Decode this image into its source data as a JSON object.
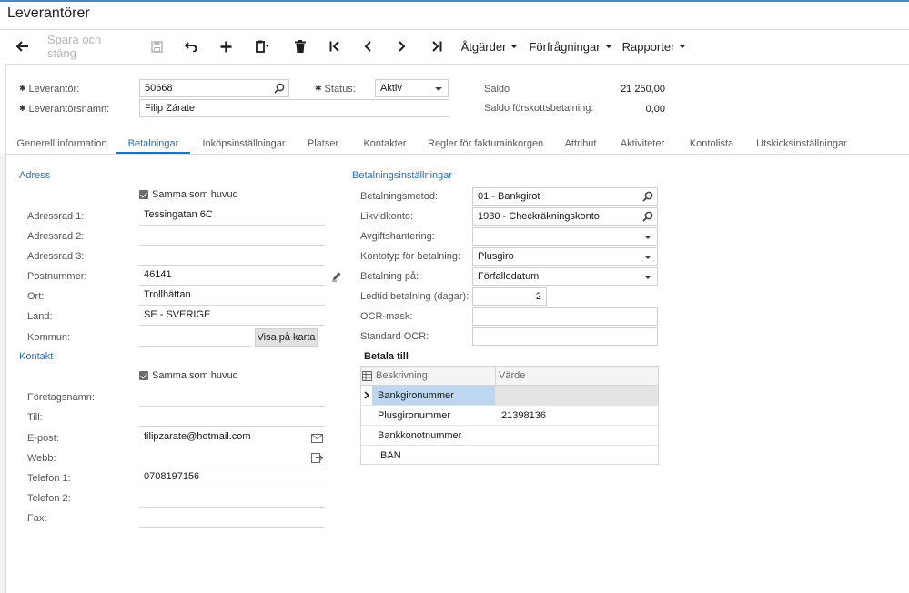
{
  "page": {
    "title": "Leverantörer"
  },
  "toolbar": {
    "save_close": "Spara och stäng",
    "actions": "Åtgärder",
    "inquiries": "Förfrågningar",
    "reports": "Rapporter"
  },
  "header": {
    "vendor_label": "Leverantör:",
    "vendor_value": "50668",
    "status_label": "Status:",
    "status_value": "Aktiv",
    "balance_label": "Saldo",
    "balance_value": "21 250,00",
    "vendor_name_label": "Leverantörsnamn:",
    "vendor_name_value": "Filip Zárate",
    "prepay_balance_label": "Saldo förskottsbetalning:",
    "prepay_balance_value": "0,00"
  },
  "tabs": [
    {
      "label": "Generell information"
    },
    {
      "label": "Betalningar"
    },
    {
      "label": "Inköpsinställningar"
    },
    {
      "label": "Platser"
    },
    {
      "label": "Kontakter"
    },
    {
      "label": "Regler för fakturainkorgen"
    },
    {
      "label": "Attribut"
    },
    {
      "label": "Aktiviteter"
    },
    {
      "label": "Kontolista"
    },
    {
      "label": "Utskicksinställningar"
    }
  ],
  "address": {
    "section": "Adress",
    "same_as_main": "Samma som huvud",
    "line1_label": "Adressrad 1:",
    "line1_value": "Tessingatan 6C",
    "line2_label": "Adressrad 2:",
    "line3_label": "Adressrad 3:",
    "postal_label": "Postnummer:",
    "postal_value": "46141",
    "city_label": "Ort:",
    "city_value": "Trollhättan",
    "country_label": "Land:",
    "country_value": "SE - SVERIGE",
    "municipality_label": "Kommun:",
    "map_button": "Visa på karta"
  },
  "contact": {
    "section": "Kontakt",
    "same_as_main": "Samma som huvud",
    "company_label": "Företagsnamn:",
    "attention_label": "Till:",
    "email_label": "E-post:",
    "email_value": "filipzarate@hotmail.com",
    "web_label": "Webb:",
    "phone1_label": "Telefon 1:",
    "phone1_value": "0708197156",
    "phone2_label": "Telefon 2:",
    "fax_label": "Fax:"
  },
  "payment": {
    "section": "Betalningsinställningar",
    "method_label": "Betalningsmetod:",
    "method_value": "01 - Bankgirot",
    "cash_account_label": "Likvidkonto:",
    "cash_account_value": "1930 - Checkräkningskonto",
    "charge_label": "Avgiftshantering:",
    "account_type_label": "Kontotyp för betalning:",
    "account_type_value": "Plusgiro",
    "pay_on_label": "Betalning på:",
    "pay_on_value": "Förfallodatum",
    "lead_days_label": "Ledtid betalning (dagar):",
    "lead_days_value": "2",
    "ocr_mask_label": "OCR-mask:",
    "default_ocr_label": "Standard OCR:",
    "pay_to_title": "Betala till",
    "grid_headers": {
      "description": "Beskrivning",
      "value": "Värde"
    },
    "grid_rows": [
      {
        "description": "Bankgironummer",
        "value": ""
      },
      {
        "description": "Plusgironummer",
        "value": "21398136"
      },
      {
        "description": "Bankkonotnummer",
        "value": ""
      },
      {
        "description": "IBAN",
        "value": ""
      }
    ]
  }
}
